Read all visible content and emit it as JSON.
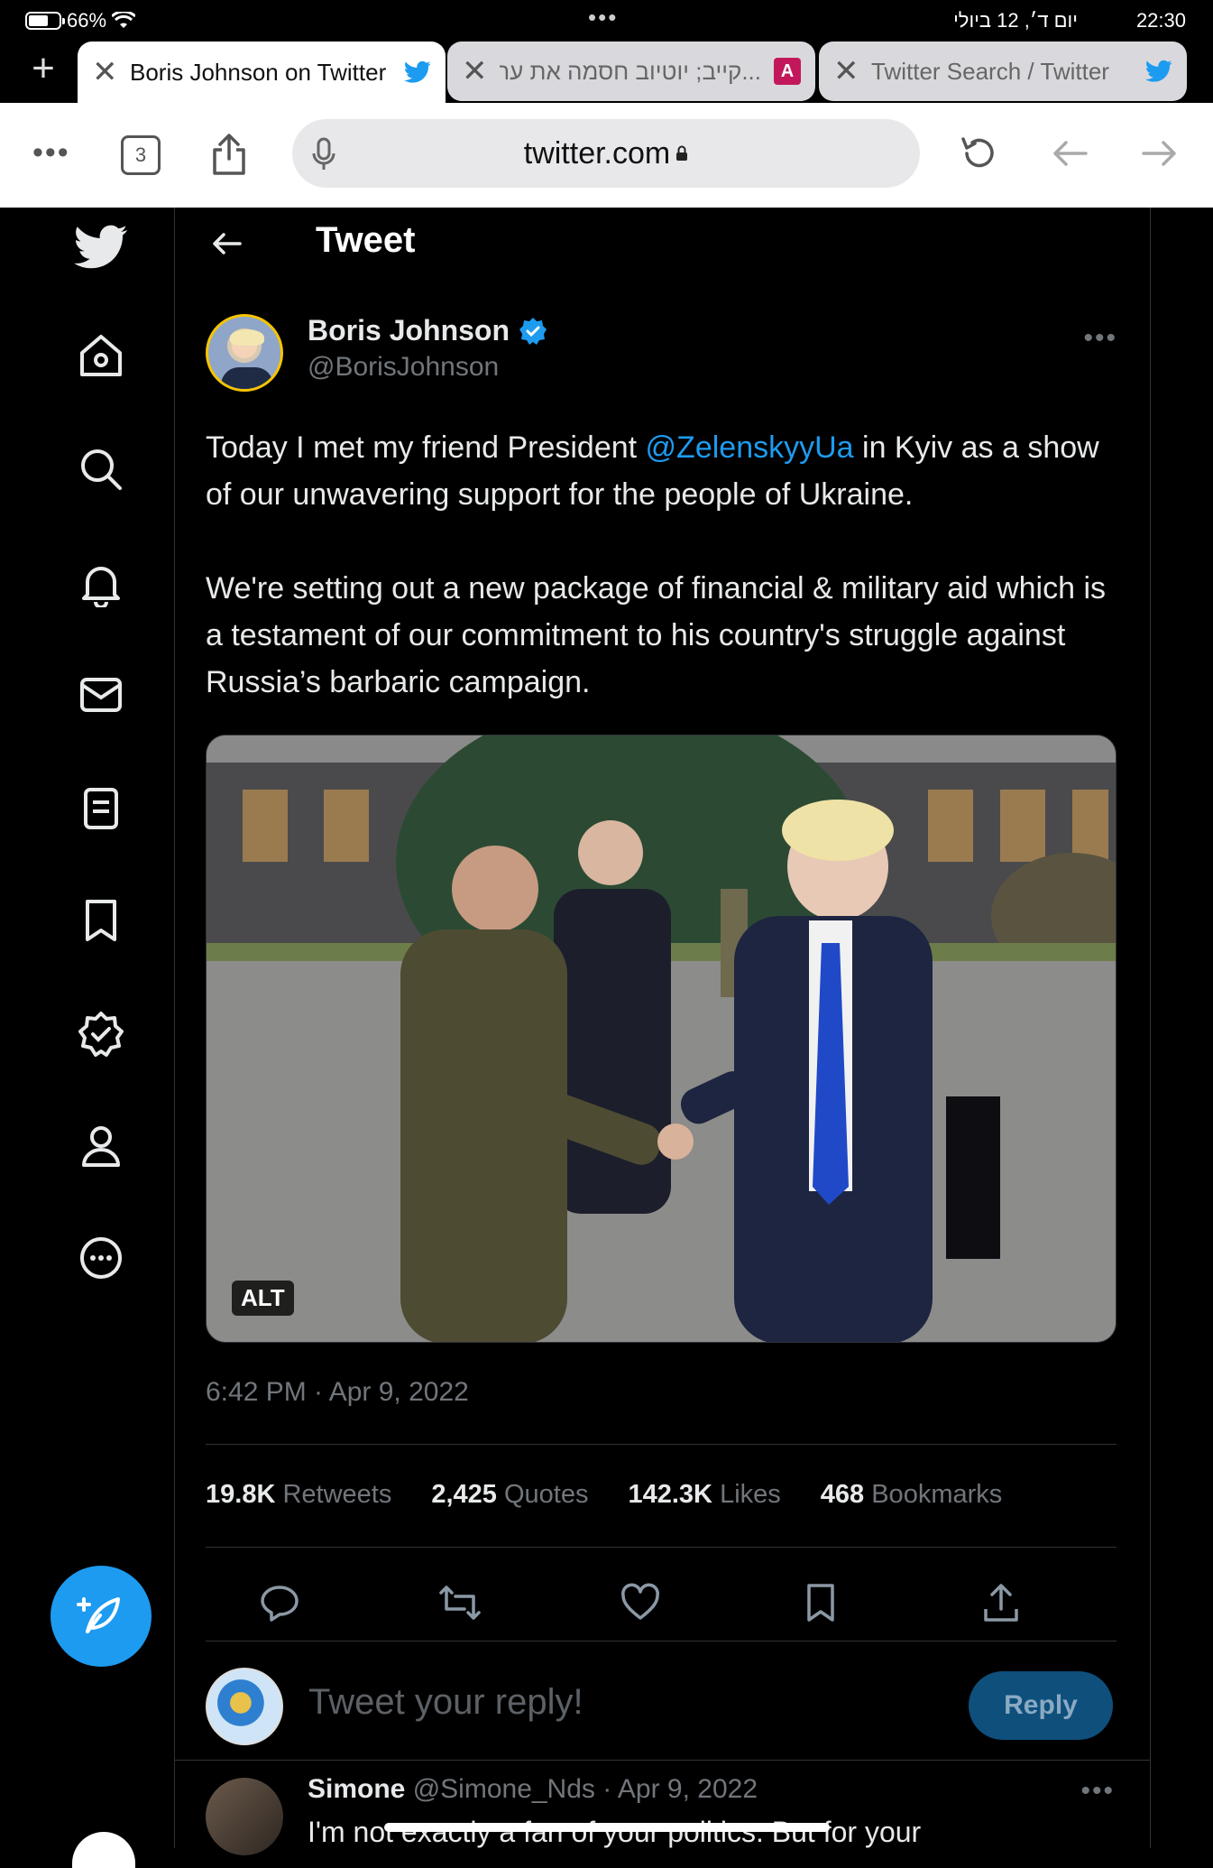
{
  "status_bar": {
    "battery": "66%",
    "battery_level": 0.66,
    "date": "יום ד׳, 12 ביולי",
    "time": "22:30"
  },
  "browser": {
    "tabs": [
      {
        "title": "Boris Johnson on Twitter",
        "active": true,
        "favicon": "twitter-bird-icon"
      },
      {
        "title": "...קייב; יוטיוב חסמה את ערוץ",
        "active": false,
        "favicon": "news-site-icon"
      },
      {
        "title": "Twitter Search / Twitter",
        "active": false,
        "favicon": "twitter-bird-icon"
      }
    ],
    "tab_count": "3",
    "url": "twitter.com",
    "news_favicon_letter": "A"
  },
  "sidebar": {
    "items": [
      "twitter-logo",
      "home",
      "explore",
      "notifications",
      "messages",
      "lists",
      "bookmarks",
      "verified",
      "profile",
      "more"
    ]
  },
  "header": {
    "title": "Tweet"
  },
  "tweet": {
    "author_name": "Boris Johnson",
    "author_handle": "@BorisJohnson",
    "text_part1": "Today I met my friend President ",
    "mention": "@ZelenskyyUa",
    "text_part2": " in Kyiv as a show of our unwavering support for the people of Ukraine.\n\nWe're setting out a new package of financial & military aid which is a testament of our commitment to his country's struggle against Russia’s barbaric campaign.",
    "alt_badge": "ALT",
    "timestamp": "6:42 PM · Apr 9, 2022",
    "stats": {
      "retweets_count": "19.8K",
      "retweets_label": "Retweets",
      "quotes_count": "2,425",
      "quotes_label": "Quotes",
      "likes_count": "142.3K",
      "likes_label": "Likes",
      "bookmarks_count": "468",
      "bookmarks_label": "Bookmarks"
    }
  },
  "reply_box": {
    "placeholder": "Tweet your reply!",
    "button": "Reply"
  },
  "first_reply": {
    "name": "Simone",
    "handle_date": "@Simone_Nds · Apr 9, 2022",
    "text": "I'm not exactly a fan of your politics. But for your"
  },
  "colors": {
    "accent": "#1d9bf0",
    "background": "#000000",
    "muted_text": "#71767b"
  }
}
